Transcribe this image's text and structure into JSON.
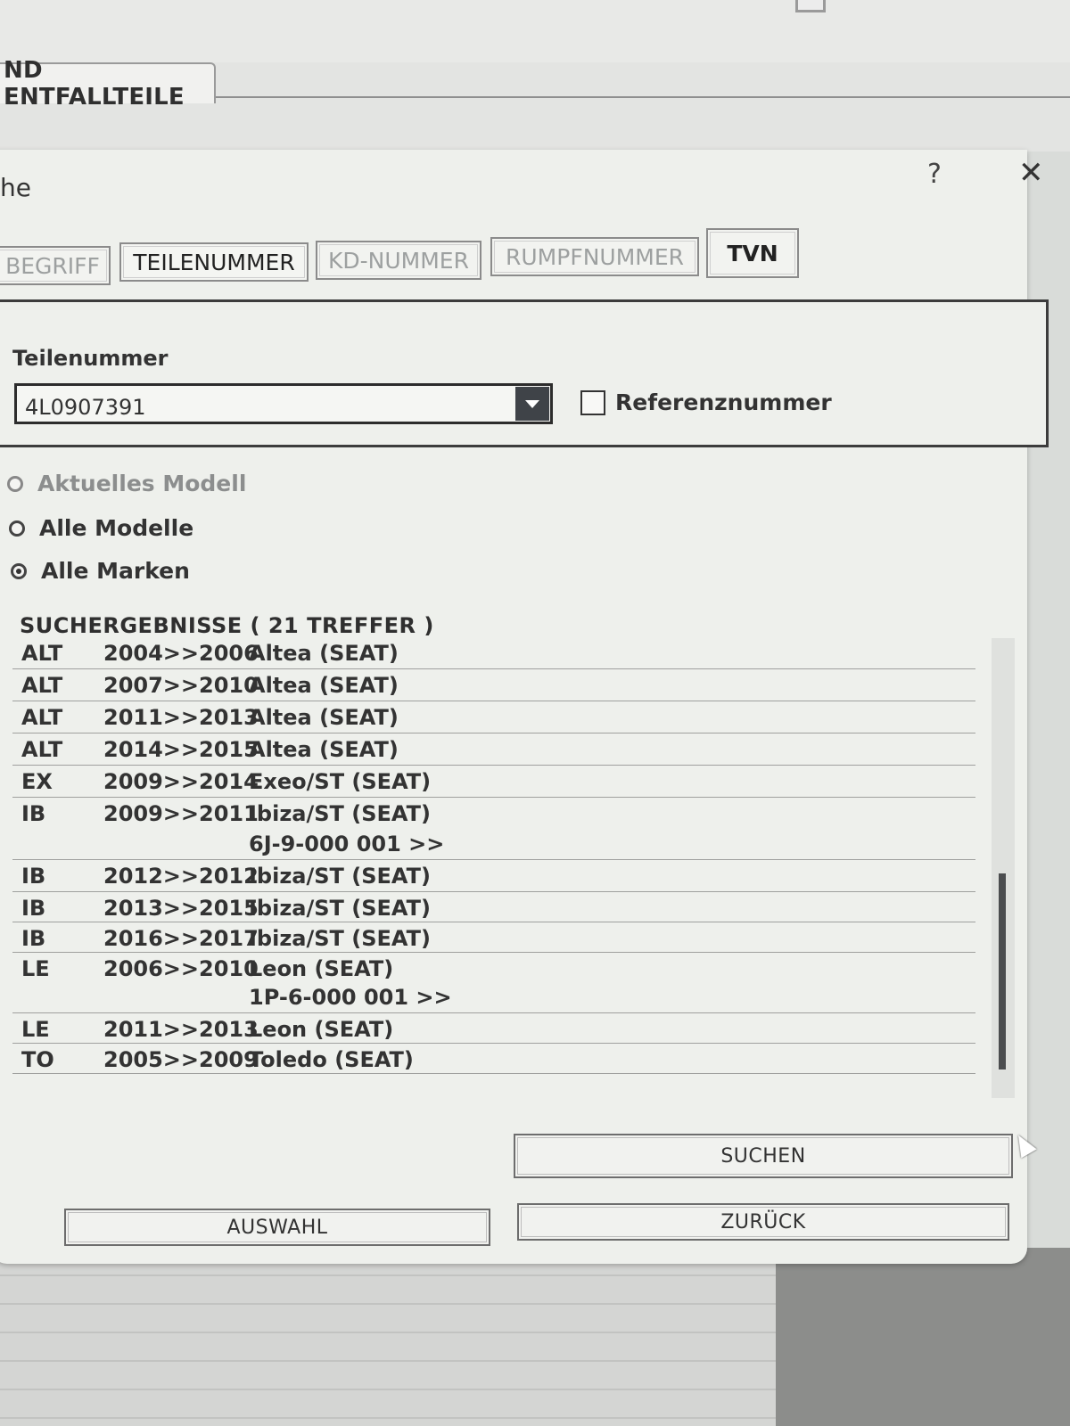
{
  "window": {
    "outer_tab_label": "ND ENTFALLTEILE",
    "title_fragment": "he",
    "help_label": "?",
    "close_label": "✕"
  },
  "tabs": [
    {
      "label": "BEGRIFF"
    },
    {
      "label": "TEILENUMMER"
    },
    {
      "label": "KD-NUMMER"
    },
    {
      "label": "RUMPFNUMMER"
    },
    {
      "label": "TVN"
    }
  ],
  "search": {
    "field_label": "Teilenummer",
    "value": "4L0907391",
    "reference_label": "Referenznummer",
    "reference_checked": false
  },
  "scope": {
    "options": [
      {
        "label": "Aktuelles Modell",
        "selected": false,
        "enabled": false
      },
      {
        "label": "Alle Modelle",
        "selected": false,
        "enabled": true
      },
      {
        "label": "Alle Marken",
        "selected": true,
        "enabled": true
      }
    ]
  },
  "results": {
    "heading": "SUCHERGEBNISSE  ( 21 TREFFER )",
    "rows": [
      {
        "code": "ALT",
        "years": "2004>>2006",
        "model": "Altea (SEAT)",
        "note": ""
      },
      {
        "code": "ALT",
        "years": "2007>>2010",
        "model": "Altea (SEAT)",
        "note": ""
      },
      {
        "code": "ALT",
        "years": "2011>>2013",
        "model": "Altea (SEAT)",
        "note": ""
      },
      {
        "code": "ALT",
        "years": "2014>>2015",
        "model": "Altea (SEAT)",
        "note": ""
      },
      {
        "code": "EX",
        "years": "2009>>2014",
        "model": "Exeo/ST (SEAT)",
        "note": ""
      },
      {
        "code": "IB",
        "years": "2009>>2011",
        "model": "Ibiza/ST (SEAT)",
        "note": "6J-9-000 001 >>"
      },
      {
        "code": "IB",
        "years": "2012>>2012",
        "model": "Ibiza/ST (SEAT)",
        "note": ""
      },
      {
        "code": "IB",
        "years": "2013>>2015",
        "model": "Ibiza/ST (SEAT)",
        "note": ""
      },
      {
        "code": "IB",
        "years": "2016>>2017",
        "model": "Ibiza/ST (SEAT)",
        "note": ""
      },
      {
        "code": "LE",
        "years": "2006>>2010",
        "model": "Leon (SEAT)",
        "note": "1P-6-000 001 >>"
      },
      {
        "code": "LE",
        "years": "2011>>2013",
        "model": "Leon (SEAT)",
        "note": ""
      },
      {
        "code": "TO",
        "years": "2005>>2009",
        "model": "Toledo (SEAT)",
        "note": ""
      }
    ]
  },
  "buttons": {
    "search": "SUCHEN",
    "select": "AUSWAHL",
    "back": "ZURÜCK"
  },
  "colors": {
    "dialog_bg": "#eef0ec",
    "scroll_thumb": "#4b4d4f",
    "dropdown_button": "#3f4348"
  }
}
